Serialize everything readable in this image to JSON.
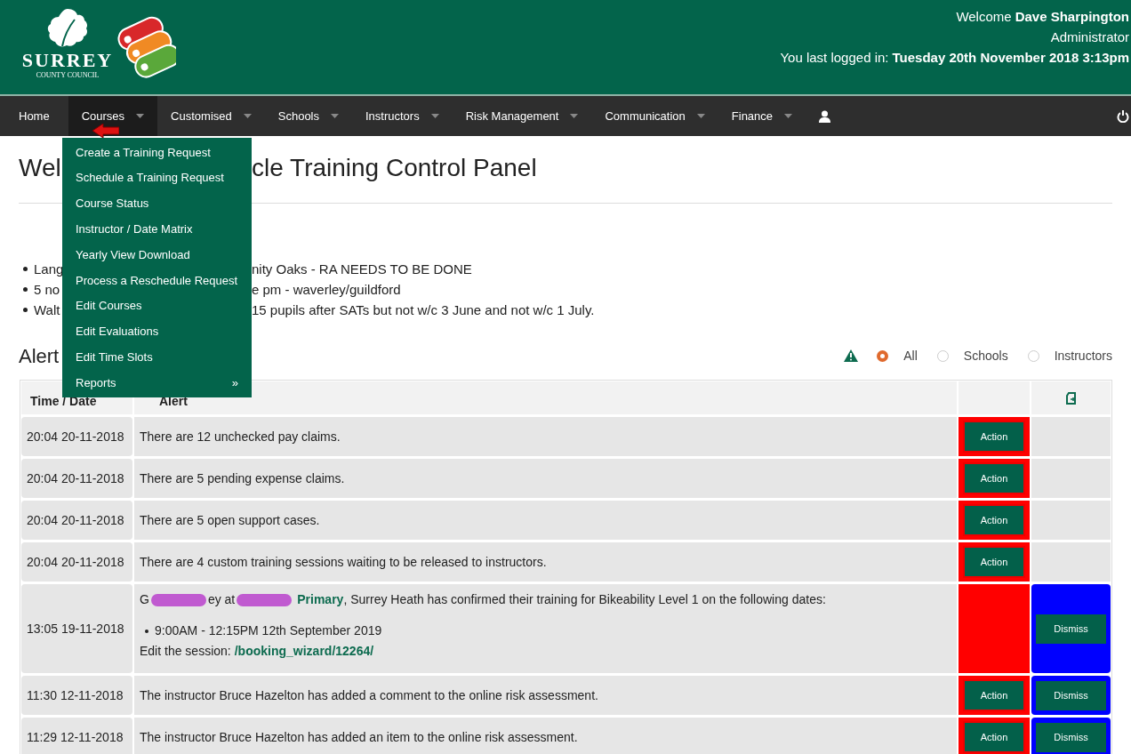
{
  "header": {
    "logo_text": "SURREY",
    "logo_subtext": "COUNTY COUNCIL",
    "welcome_label": "Welcome",
    "user_name": "Dave Sharpington",
    "role": "Administrator",
    "last_login_label": "You last logged in:",
    "last_login": "Tuesday 20th November 2018 3:13pm"
  },
  "nav": {
    "items": [
      {
        "label": "Home",
        "dropdown": false,
        "selected": false
      },
      {
        "label": "Courses",
        "dropdown": true,
        "selected": true
      },
      {
        "label": "Customised",
        "dropdown": true,
        "selected": false
      },
      {
        "label": "Schools",
        "dropdown": true,
        "selected": false
      },
      {
        "label": "Instructors",
        "dropdown": true,
        "selected": false
      },
      {
        "label": "Risk Management",
        "dropdown": true,
        "selected": false
      },
      {
        "label": "Communication",
        "dropdown": true,
        "selected": false
      },
      {
        "label": "Finance",
        "dropdown": true,
        "selected": false
      }
    ],
    "menu": [
      {
        "label": "Create a Training Request"
      },
      {
        "label": "Schedule a Training Request"
      },
      {
        "label": "Course Status"
      },
      {
        "label": "Instructor / Date Matrix"
      },
      {
        "label": "Yearly View Download"
      },
      {
        "label": "Process a Reschedule Request"
      },
      {
        "label": "Edit Courses"
      },
      {
        "label": "Edit Evaluations"
      },
      {
        "label": "Edit Time Slots"
      },
      {
        "label": "Reports",
        "submenu": "»"
      }
    ]
  },
  "title": {
    "visible_start": "Wel",
    "visible_end": "cle Training Control Panel"
  },
  "notes": [
    {
      "visible_start": "Lang",
      "visible_end": "nity Oaks - RA NEEDS TO BE DONE"
    },
    {
      "visible_start": "5 no",
      "visible_end": "e pm - waverley/guildford"
    },
    {
      "visible_start": "Walt",
      "visible_end": "15 pupils after SATs but not w/c 3 June and not w/c 1 July."
    }
  ],
  "alerts": {
    "title": "Alert",
    "filters": [
      {
        "label": "All",
        "selected": true
      },
      {
        "label": "Schools",
        "selected": false
      },
      {
        "label": "Instructors",
        "selected": false
      }
    ],
    "columns": [
      "Time / Date",
      "Alert"
    ],
    "rows": [
      {
        "time": "20:04 20-11-2018",
        "message": "There are 12 unchecked pay claims.",
        "action": "Action"
      },
      {
        "time": "20:04 20-11-2018",
        "message": "There are 5 pending expense claims.",
        "action": "Action"
      },
      {
        "time": "20:04 20-11-2018",
        "message": "There are 5 open support cases.",
        "action": "Action"
      },
      {
        "time": "20:04 20-11-2018",
        "message": "There are 4 custom training sessions waiting to be released to instructors.",
        "action": "Action"
      },
      {
        "time": "13:05 19-11-2018",
        "kind": "booking",
        "parts": [
          {
            "kind": "text",
            "text": "G"
          },
          {
            "kind": "redacted"
          },
          {
            "kind": "text",
            "text": "ey at"
          },
          {
            "kind": "redacted"
          },
          {
            "kind": "link",
            "text": "Primary"
          },
          {
            "kind": "text",
            "text": ", Surrey Heath has confirmed their training for Bikeability Level 1 on the following dates:"
          }
        ],
        "dates": [
          "9:00AM - 12:15PM 12th September 2019"
        ],
        "edit_label": "Edit the session:",
        "edit_link": "/booking_wizard/12264/",
        "dismiss": "Dismiss"
      },
      {
        "time": "11:30 12-11-2018",
        "message": "The instructor Bruce Hazelton has added a comment to the online risk assessment.",
        "action": "Action",
        "dismiss": "Dismiss"
      },
      {
        "time": "11:29 12-11-2018",
        "message": "The instructor Bruce Hazelton has added an item to the online risk assessment.",
        "action": "Action",
        "dismiss": "Dismiss"
      }
    ]
  }
}
